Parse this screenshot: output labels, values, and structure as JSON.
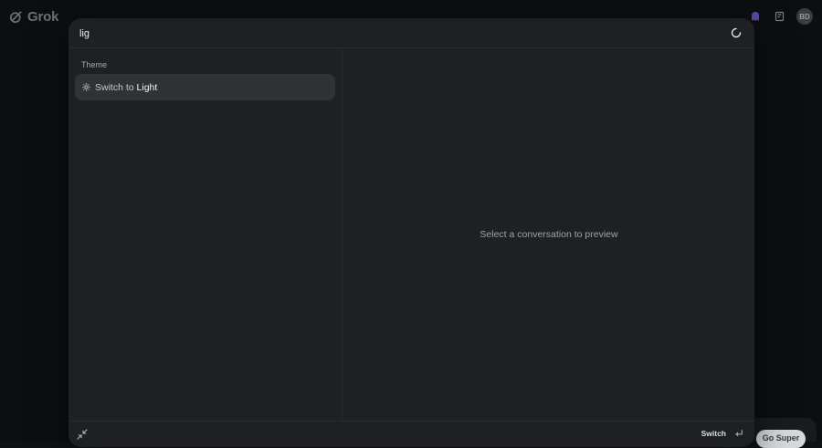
{
  "brand": {
    "name": "Grok"
  },
  "header": {
    "avatar_initials": "BD"
  },
  "background": {
    "cta_label": "Go Super"
  },
  "search": {
    "value": "lig"
  },
  "results": {
    "section_title": "Theme",
    "items": [
      {
        "prefix": "Switch to ",
        "match": "Light",
        "icon": "sun-icon"
      }
    ]
  },
  "preview": {
    "empty_message": "Select a conversation to preview"
  },
  "footer": {
    "action_label": "Switch",
    "action_icon": "enter-icon",
    "collapse_icon": "collapse-icon"
  },
  "colors": {
    "modal_bg": "#1f2023",
    "item_highlight": "#313236",
    "page_bg": "#0d0e0f"
  }
}
